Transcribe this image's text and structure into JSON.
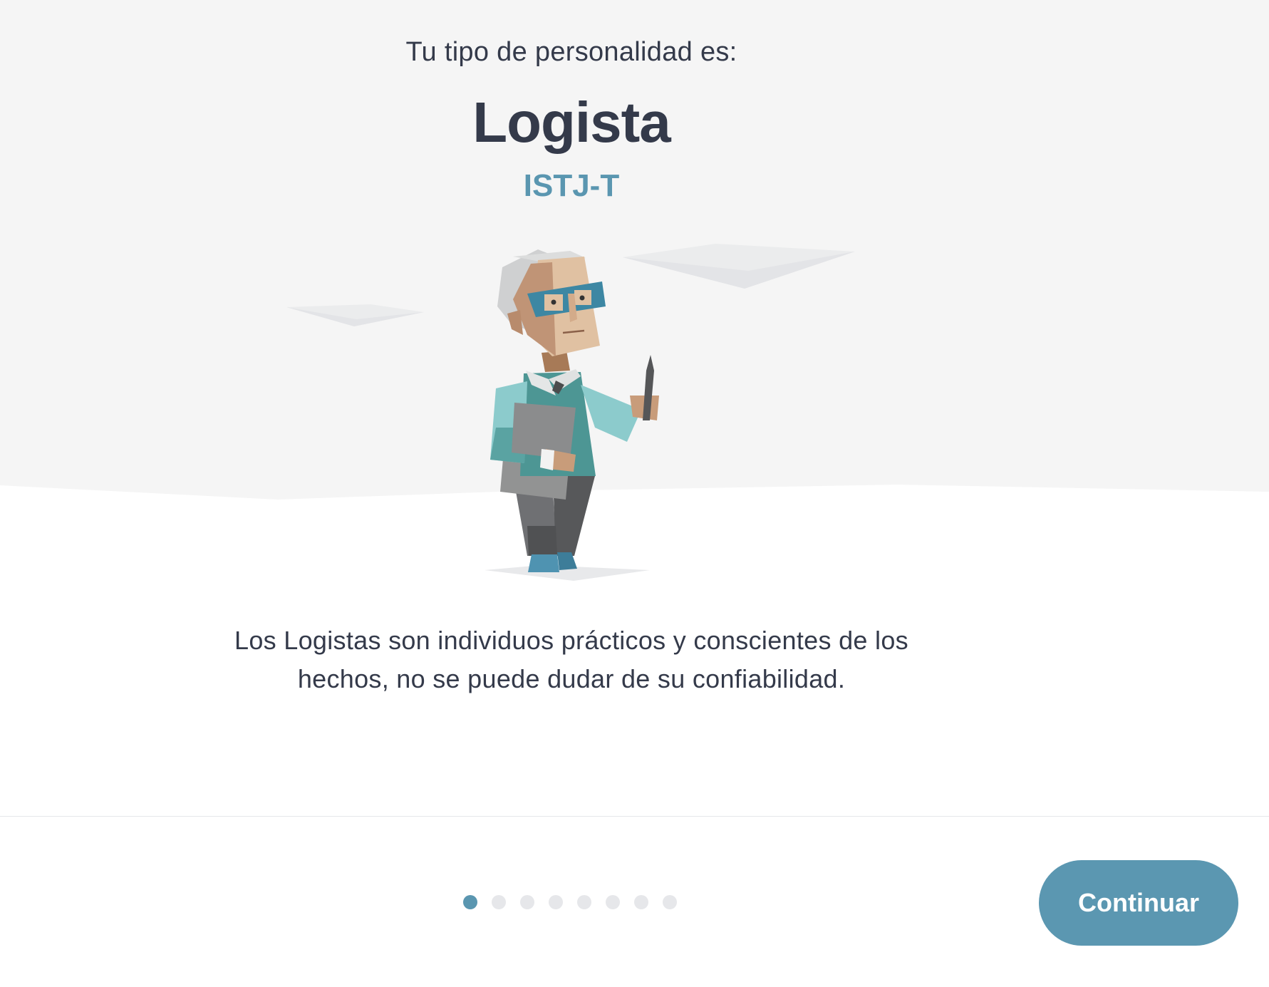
{
  "header": {
    "intro": "Tu tipo de personalidad es:",
    "type_name": "Logista",
    "type_code": "ISTJ-T"
  },
  "illustration": {
    "icon": "logistician-character-illustration"
  },
  "description": {
    "line1": "Los Logistas son individuos prácticos y conscientes de los",
    "line2": "hechos, no se puede dudar de su confiabilidad."
  },
  "pager": {
    "total": 8,
    "current": 1
  },
  "footer": {
    "continue_label": "Continuar"
  },
  "colors": {
    "accent": "#5b97b1",
    "text": "#343a4a",
    "hero_background": "#f5f5f5",
    "inactive_dot": "#e6e7ea"
  }
}
